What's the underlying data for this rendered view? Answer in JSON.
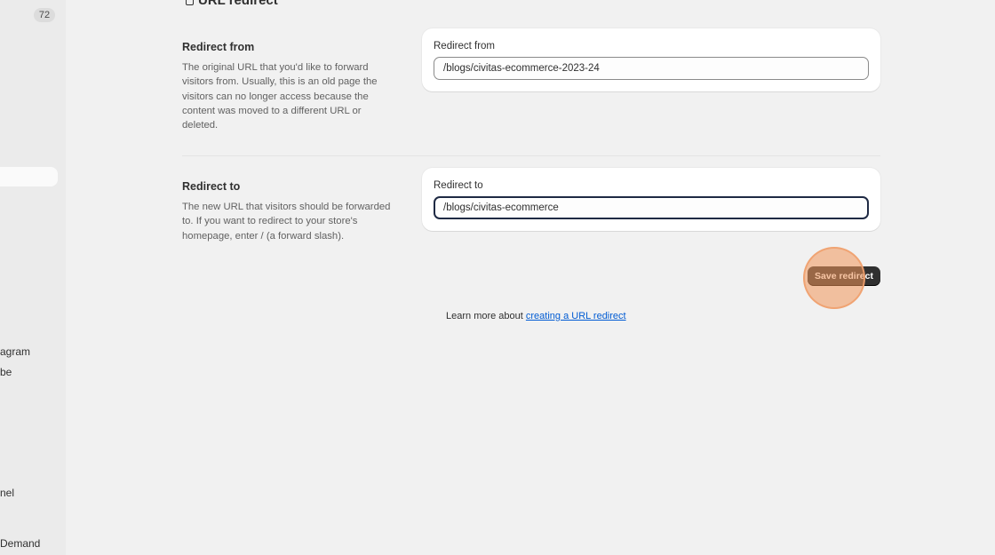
{
  "sidebar": {
    "badge_count": "72",
    "items": [
      {
        "label": "agram"
      },
      {
        "label": "be"
      },
      {
        "label": "nel"
      },
      {
        "label": " Demand"
      }
    ]
  },
  "page": {
    "title": "URL redirect"
  },
  "redirect_from": {
    "heading": "Redirect from",
    "description": "The original URL that you'd like to forward visitors from. Usually, this is an old page the visitors can no longer access because the content was moved to a different URL or deleted.",
    "field_label": "Redirect from",
    "value": "/blogs/civitas-ecommerce-2023-24"
  },
  "redirect_to": {
    "heading": "Redirect to",
    "description": "The new URL that visitors should be forwarded to. If you want to redirect to your store's homepage, enter / (a forward slash).",
    "field_label": "Redirect to",
    "value": "/blogs/civitas-ecommerce"
  },
  "actions": {
    "save_label": "Save redirect"
  },
  "footer": {
    "learn_more_prefix": "Learn more about ",
    "learn_more_link": "creating a URL redirect"
  }
}
